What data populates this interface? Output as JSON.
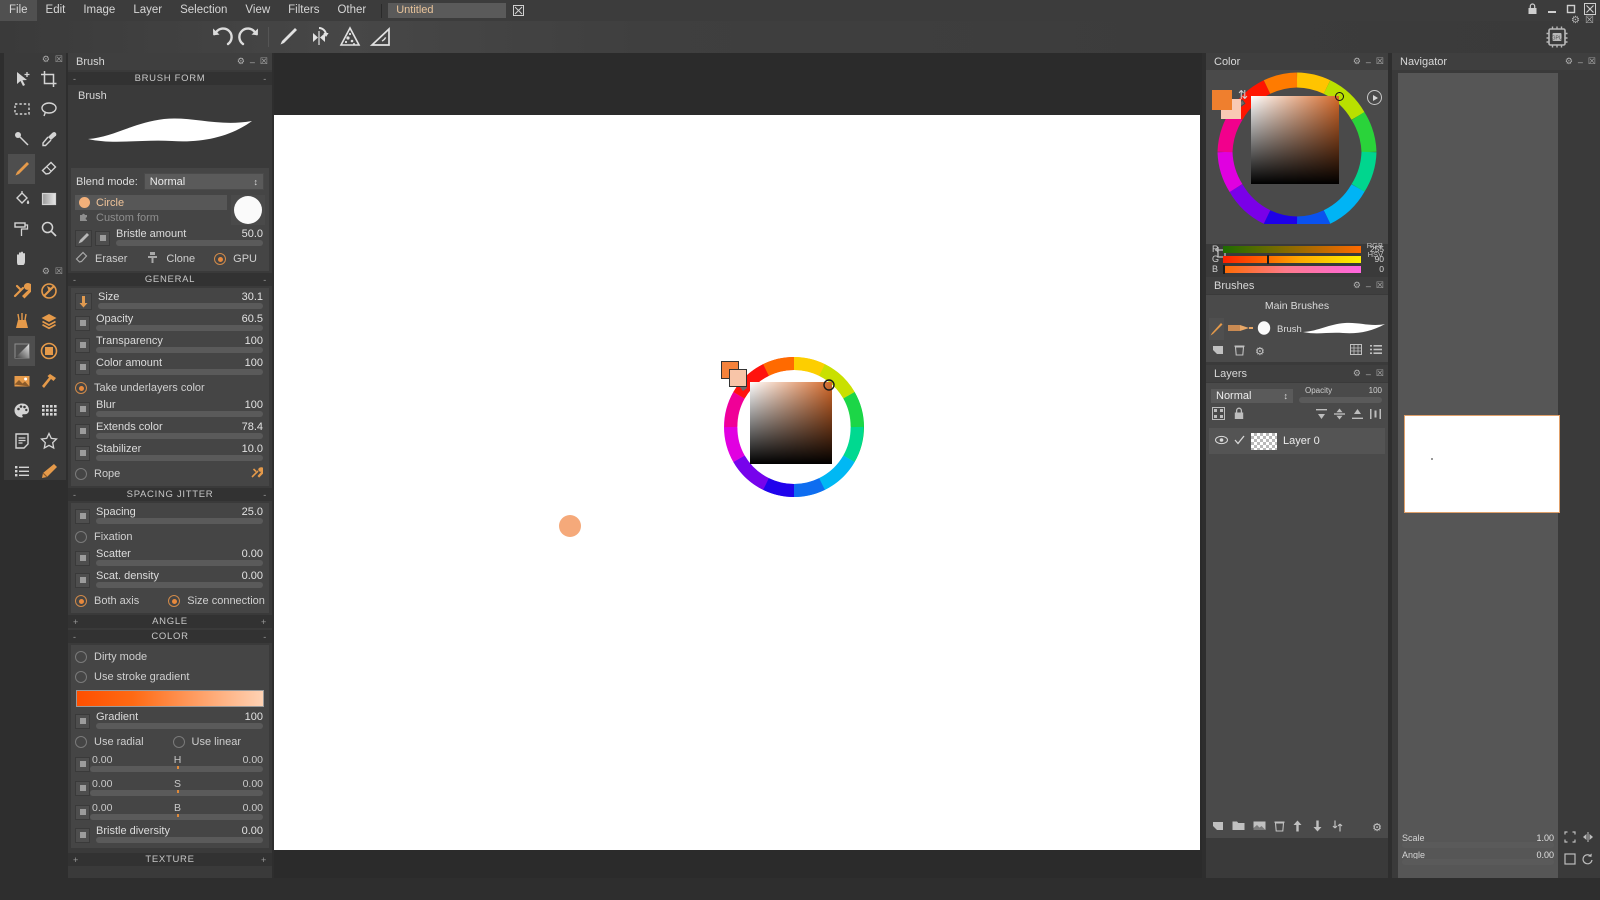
{
  "app": {
    "menu": [
      "File",
      "Edit",
      "Image",
      "Layer",
      "Selection",
      "View",
      "Filters",
      "Other"
    ],
    "document_tab": "Untitled",
    "document_tab_close": "☒",
    "window_controls": [
      "lock-icon",
      "minimize-icon",
      "maximize-icon",
      "close-icon"
    ],
    "toolbar_icons": [
      "undo-icon",
      "redo-icon",
      "brush-icon",
      "symmetry-icon",
      "scatter-icon",
      "ruler-icon",
      "gpu-icon"
    ]
  },
  "tools": {
    "group1": [
      "move-icon",
      "crop-icon",
      "rect-select-icon",
      "lasso-icon",
      "smudge-icon",
      "eyedropper-icon",
      "brush-icon",
      "eraser-icon",
      "bucket-fill-icon",
      "gradient-icon",
      "roller-icon",
      "zoom-icon",
      "hand-icon"
    ],
    "group2": [
      "tools-icon",
      "pen-tool-icon",
      "quick-mask-icon",
      "layers-icon",
      "contrast-icon",
      "circle-shade-icon",
      "image-icon",
      "hammer-icon",
      "palette-icon",
      "grid-icon",
      "notes-icon",
      "star-icon",
      "list-icon",
      "stamp-icon"
    ],
    "selected": "brush-icon"
  },
  "brush_panel": {
    "title": "Brush",
    "sections": {
      "brush_form": "BRUSH FORM",
      "general": "GENERAL",
      "spacing_jitter": "SPACING JITTER",
      "angle": "ANGLE",
      "color": "COLOR",
      "texture": "TEXTURE"
    },
    "brush_label": "Brush",
    "blend_mode_label": "Blend mode:",
    "blend_mode_value": "Normal",
    "form_circle": "Circle",
    "form_custom": "Custom form",
    "bristle": {
      "label": "Bristle amount",
      "value": "50.0",
      "pct": 50
    },
    "eraser": "Eraser",
    "clone": "Clone",
    "gpu": "GPU",
    "general_sliders": [
      {
        "label": "Size",
        "value": "30.1",
        "pct": 30
      },
      {
        "label": "Opacity",
        "value": "60.5",
        "pct": 72
      },
      {
        "label": "Transparency",
        "value": "100",
        "pct": 100
      },
      {
        "label": "Color amount",
        "value": "100",
        "pct": 100
      },
      {
        "label": "Blur",
        "value": "100",
        "pct": 100
      },
      {
        "label": "Extends color",
        "value": "78.4",
        "pct": 78
      },
      {
        "label": "Stabilizer",
        "value": "10.0",
        "pct": 3
      }
    ],
    "take_underlayers_color": "Take underlayers color",
    "rope": "Rope",
    "spacing_sliders": [
      {
        "label": "Spacing",
        "value": "25.0",
        "pct": 32
      },
      {
        "label": "Scatter",
        "value": "0.00",
        "pct": 1
      },
      {
        "label": "Scat. density",
        "value": "0.00",
        "pct": 1
      }
    ],
    "fixation": "Fixation",
    "both_axis": "Both axis",
    "size_connection": "Size connection",
    "dirty_mode": "Dirty mode",
    "use_stroke_gradient": "Use stroke gradient",
    "gradient": {
      "label": "Gradient",
      "value": "100",
      "pct": 100
    },
    "use_radial": "Use radial",
    "use_linear": "Use linear",
    "hsb": [
      {
        "left": "0.00",
        "center": "H",
        "right": "0.00"
      },
      {
        "left": "0.00",
        "center": "S",
        "right": "0.00"
      },
      {
        "left": "0.00",
        "center": "B",
        "right": "0.00"
      }
    ],
    "bristle_diversity": {
      "label": "Bristle diversity",
      "value": "0.00",
      "pct": 1
    }
  },
  "color_panel": {
    "title": "Color",
    "mode_rgb": "RGB",
    "mode_hsv": "HSV",
    "channels": [
      {
        "name": "R",
        "value": "255"
      },
      {
        "name": "G",
        "value": "90"
      },
      {
        "name": "B",
        "value": "0"
      }
    ]
  },
  "brushes_panel": {
    "title": "Brushes",
    "category": "Main Brushes",
    "brush_name": "Brush"
  },
  "layers_panel": {
    "title": "Layers",
    "blend_mode": "Normal",
    "opacity_label": "Opacity",
    "opacity_value": "100",
    "layers": [
      {
        "name": "Layer 0",
        "visible": true,
        "checked": true
      }
    ]
  },
  "navigator_panel": {
    "title": "Navigator",
    "scale": {
      "label": "Scale",
      "value": "1.00",
      "pct": 50
    },
    "angle": {
      "label": "Angle",
      "value": "0.00",
      "pct": 0
    }
  }
}
